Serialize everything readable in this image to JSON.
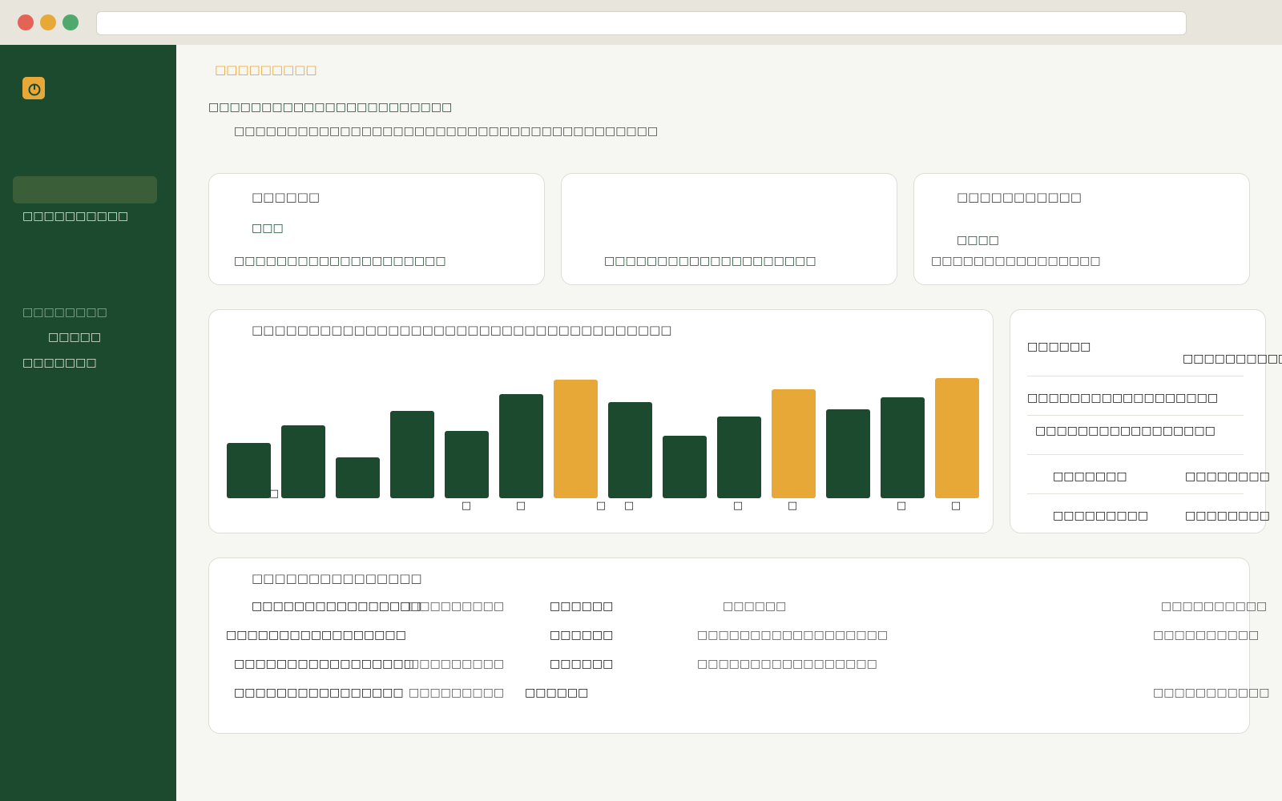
{
  "window": {
    "traffic_lights": [
      "#e36456",
      "#e8a838",
      "#4fa86c"
    ],
    "url": ""
  },
  "sidebar": {
    "logo_icon": "power-icon",
    "nav_item_1": "□□□□□□□□□□",
    "section_label": "□□□□□□□□",
    "nav_item_2": "□□□□□",
    "nav_item_3": "□□□□□□□",
    "colors": {
      "bg": "#1c4a2e",
      "active": "#3a5e37",
      "accent": "#e8a838"
    }
  },
  "header": {
    "eyebrow": "□□□□□□□□□",
    "title": "□□□□□□□□□□□□□□□□□□□□□□□",
    "subtitle": "□□□□□□□□□□□□□□□□□□□□□□□□□□□□□□□□□□□□□□□□"
  },
  "stat_cards": [
    {
      "label": "□□□□□□",
      "value": "□□□",
      "note": "□□□□□□□□□□□□□□□□□□□□"
    },
    {
      "label": "",
      "value": "",
      "note": "□□□□□□□□□□□□□□□□□□□□"
    },
    {
      "label": "□□□□□□□□□□□",
      "value": "□□□□",
      "note": "□□□□□□□□□□□□□□□□"
    }
  ],
  "chart_card": {
    "title": "□□□□□□□□□□□□□□□□□□□□□□□□□□□□□□□□□□□□□",
    "colors": {
      "normal": "#1c4a2e",
      "highlight": "#e8a838"
    }
  },
  "chart_data": {
    "type": "bar",
    "title": "",
    "categories": [
      "",
      "",
      "",
      "",
      "",
      "",
      "",
      "",
      "",
      "",
      "",
      "",
      "",
      ""
    ],
    "values": [
      46,
      61,
      34,
      73,
      56,
      87,
      99,
      80,
      52,
      68,
      91,
      74,
      84,
      100
    ],
    "highlighted": [
      false,
      false,
      false,
      false,
      false,
      false,
      true,
      false,
      false,
      false,
      true,
      false,
      false,
      true
    ],
    "tick_labels": [
      "□",
      "□",
      "□",
      "□",
      "□",
      "□",
      "□",
      "□",
      "□"
    ],
    "ylim": [
      0,
      100
    ],
    "grid": false
  },
  "side_list": {
    "row1_left": "□□□□□□",
    "row1_right": "□□□□□□□□□□",
    "row2": "□□□□□□□□□□□□□□□□□□",
    "row3": "□□□□□□□□□□□□□□□□□",
    "row4_left": "□□□□□□□",
    "row4_right": "□□□□□□□□",
    "row5_left": "□□□□□□□□□",
    "row5_right": "□□□□□□□□"
  },
  "table": {
    "title": "□□□□□□□□□□□□□□□",
    "rows": [
      [
        "□□□□□□□□□□□□□□□□",
        "□□□□□□□□□",
        "□□□□□□",
        "□□□□□□",
        "□□□□□□□□□□"
      ],
      [
        "□□□□□□□□□□□□□□□□□",
        "",
        "□□□□□□",
        "□□□□□□□□□□□□□□□□□□",
        "□□□□□□□□□□"
      ],
      [
        "□□□□□□□□□□□□□□□□□",
        "□□□□□□□□□",
        "□□□□□□",
        "□□□□□□□□□□□□□□□□□",
        ""
      ],
      [
        "□□□□□□□□□□□□□□□□",
        "□□□□□□□□□",
        "□□□□□□",
        "",
        "□□□□□□□□□□□"
      ]
    ]
  }
}
